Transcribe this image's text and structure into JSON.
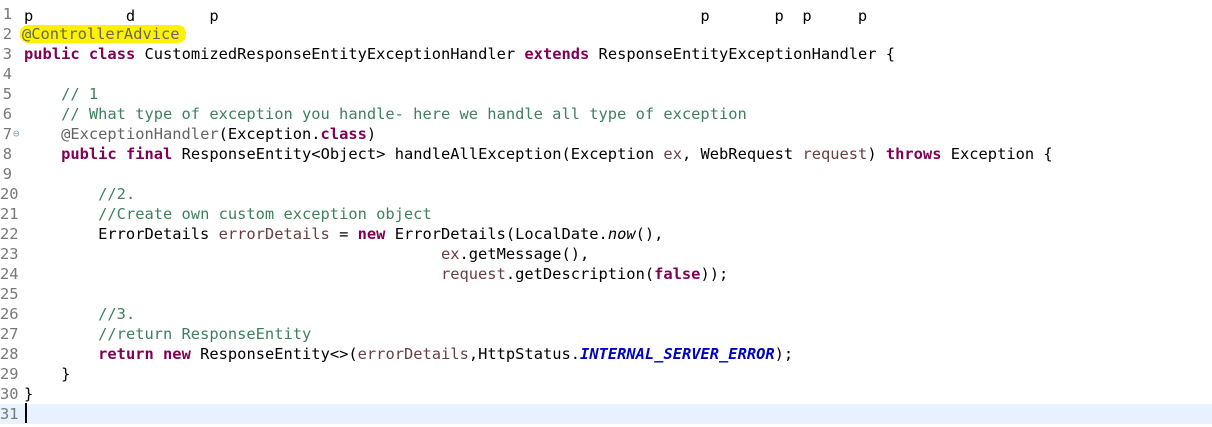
{
  "editor": {
    "top_partial": "p          d        p                                                    p       p  p     p",
    "lines": [
      {
        "num": "1",
        "tokens": []
      },
      {
        "num": "2",
        "highlight": true,
        "tokens": [
          {
            "t": "@ControllerAdvice",
            "c": "an"
          }
        ]
      },
      {
        "num": "3",
        "tokens": [
          {
            "t": "public",
            "c": "kw"
          },
          {
            "t": " "
          },
          {
            "t": "class",
            "c": "kw"
          },
          {
            "t": " CustomizedResponseEntityExceptionHandler "
          },
          {
            "t": "extends",
            "c": "kw"
          },
          {
            "t": " ResponseEntityExceptionHandler {"
          }
        ]
      },
      {
        "num": "4",
        "tokens": []
      },
      {
        "num": "5",
        "tokens": [
          {
            "t": "    "
          },
          {
            "t": "// 1",
            "c": "cm"
          }
        ]
      },
      {
        "num": "6",
        "tokens": [
          {
            "t": "    "
          },
          {
            "t": "// What type of exception you handle- here we handle all type of exception",
            "c": "cm"
          }
        ]
      },
      {
        "num": "7",
        "fold": "⊖",
        "tokens": [
          {
            "t": "    "
          },
          {
            "t": "@ExceptionHandler",
            "c": "an"
          },
          {
            "t": "(Exception."
          },
          {
            "t": "class",
            "c": "kw"
          },
          {
            "t": ")"
          }
        ]
      },
      {
        "num": "8",
        "tokens": [
          {
            "t": "    "
          },
          {
            "t": "public",
            "c": "kw"
          },
          {
            "t": " "
          },
          {
            "t": "final",
            "c": "kw"
          },
          {
            "t": " ResponseEntity<Object> handleAllException(Exception "
          },
          {
            "t": "ex",
            "c": "prm"
          },
          {
            "t": ", WebRequest "
          },
          {
            "t": "request",
            "c": "prm"
          },
          {
            "t": ") "
          },
          {
            "t": "throws",
            "c": "kw"
          },
          {
            "t": " Exception {"
          }
        ]
      },
      {
        "num": "9",
        "tokens": []
      },
      {
        "num": "20",
        "tokens": [
          {
            "t": "        "
          },
          {
            "t": "//2.",
            "c": "cm"
          }
        ]
      },
      {
        "num": "21",
        "tokens": [
          {
            "t": "        "
          },
          {
            "t": "//Create own custom exception object",
            "c": "cm"
          }
        ]
      },
      {
        "num": "22",
        "tokens": [
          {
            "t": "        ErrorDetails "
          },
          {
            "t": "errorDetails",
            "c": "lv"
          },
          {
            "t": " = "
          },
          {
            "t": "new",
            "c": "kw"
          },
          {
            "t": " ErrorDetails(LocalDate."
          },
          {
            "t": "now",
            "c": "it"
          },
          {
            "t": "(),"
          }
        ]
      },
      {
        "num": "23",
        "tokens": [
          {
            "t": "                                             "
          },
          {
            "t": "ex",
            "c": "prm"
          },
          {
            "t": ".getMessage(),"
          }
        ]
      },
      {
        "num": "24",
        "tokens": [
          {
            "t": "                                             "
          },
          {
            "t": "request",
            "c": "prm"
          },
          {
            "t": ".getDescription("
          },
          {
            "t": "false",
            "c": "kw"
          },
          {
            "t": "));"
          }
        ]
      },
      {
        "num": "25",
        "tokens": []
      },
      {
        "num": "26",
        "tokens": [
          {
            "t": "        "
          },
          {
            "t": "//3.",
            "c": "cm"
          }
        ]
      },
      {
        "num": "27",
        "tokens": [
          {
            "t": "        "
          },
          {
            "t": "//return ResponseEntity",
            "c": "cm"
          }
        ]
      },
      {
        "num": "28",
        "tokens": [
          {
            "t": "        "
          },
          {
            "t": "return",
            "c": "kw"
          },
          {
            "t": " "
          },
          {
            "t": "new",
            "c": "kw"
          },
          {
            "t": " ResponseEntity<>("
          },
          {
            "t": "errorDetails",
            "c": "lv"
          },
          {
            "t": ",HttpStatus."
          },
          {
            "t": "INTERNAL_SERVER_ERROR",
            "c": "cst"
          },
          {
            "t": ");"
          }
        ]
      },
      {
        "num": "29",
        "tokens": [
          {
            "t": "    }"
          }
        ]
      },
      {
        "num": "30",
        "tokens": [
          {
            "t": "}"
          }
        ]
      },
      {
        "num": "31",
        "current": true,
        "tokens": []
      }
    ]
  }
}
